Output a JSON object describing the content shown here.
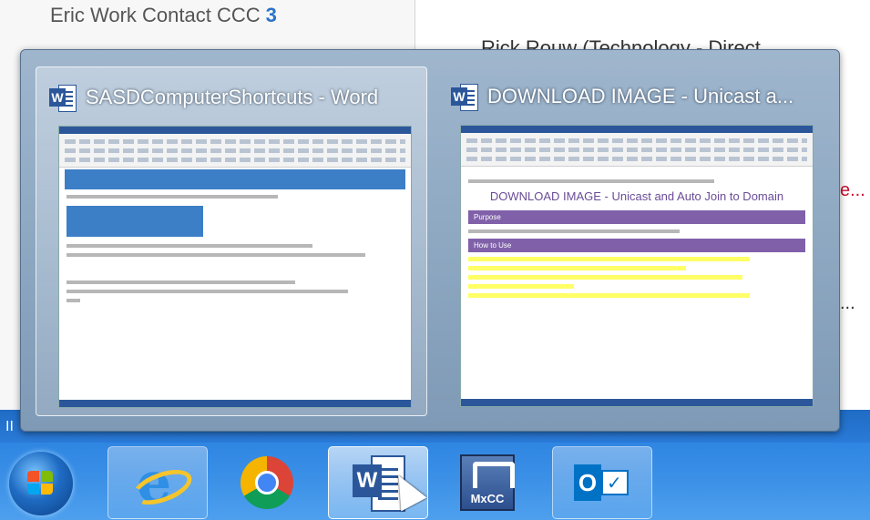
{
  "background": {
    "contact_label": "Eric Work Contact CCC",
    "contact_count": "3",
    "name_partial": "Rick Rouw (Technology - Direct...",
    "red_partial": "e...",
    "trailing_ellipsis": "..."
  },
  "popup": {
    "thumbnails": [
      {
        "title": "SASDComputerShortcuts - Word",
        "icon": "word-icon",
        "active": true
      },
      {
        "title": "DOWNLOAD IMAGE - Unicast a...",
        "icon": "word-icon",
        "active": false,
        "doc_heading": "DOWNLOAD IMAGE - Unicast and Auto Join to Domain",
        "section_1": "Purpose",
        "section_2": "How to Use"
      }
    ]
  },
  "taskbar": {
    "strip_label": "II",
    "buttons": [
      {
        "name": "start-button",
        "icon": "windows-start-icon"
      },
      {
        "name": "internet-explorer",
        "icon": "internet-explorer-icon"
      },
      {
        "name": "chrome",
        "icon": "chrome-icon"
      },
      {
        "name": "word",
        "icon": "word-icon",
        "label": "W"
      },
      {
        "name": "mxcc",
        "icon": "mxcc-icon",
        "label": "MxCC"
      },
      {
        "name": "outlook",
        "icon": "outlook-icon",
        "label": "O"
      }
    ]
  },
  "colors": {
    "taskbar": "#2f86e2",
    "word_blue": "#2b579a",
    "doc_purple": "#8061a9",
    "highlight_yellow": "#ffff66",
    "contact_count": "#2b73c8"
  }
}
